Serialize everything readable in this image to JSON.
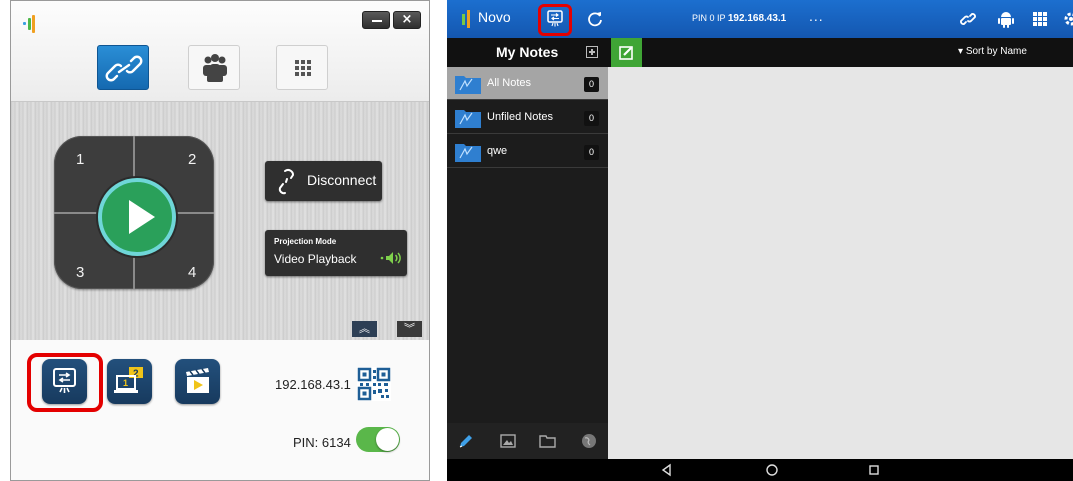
{
  "left_app": {
    "tabs": [
      {
        "name": "link",
        "active": true
      },
      {
        "name": "users",
        "active": false
      },
      {
        "name": "apps",
        "active": false
      }
    ],
    "pad_quadrants": [
      "1",
      "2",
      "3",
      "4"
    ],
    "disconnect_label": "Disconnect",
    "projection_mode": {
      "title": "Projection Mode",
      "value": "Video Playback"
    },
    "ip_address": "192.168.43.1",
    "pin_label": "PIN: 6134",
    "pin_enabled": true,
    "bottom_buttons": [
      "screen-share-icon",
      "presenter-icon",
      "video-clapper-icon"
    ],
    "highlight_color": "#e40000",
    "accent_color": "#1e7ac6"
  },
  "right_app": {
    "app_name": "Novo",
    "pin_ip_prefix": "PIN 0 IP ",
    "pin_ip_address": "192.168.43.1",
    "more": "...",
    "notes_title": "My Notes",
    "sort_label": "Sort by Name",
    "notebooks": [
      {
        "name": "All Notes",
        "count": "0",
        "selected": true
      },
      {
        "name": "Unfiled Notes",
        "count": "0",
        "selected": false
      },
      {
        "name": "qwe",
        "count": "0",
        "selected": false
      }
    ],
    "top_icons": [
      "link-icon",
      "android-icon",
      "grid-icon",
      "settings-icon"
    ],
    "bottom_tools": [
      "pen-icon",
      "image-icon",
      "folder-icon",
      "globe-icon"
    ],
    "nav": [
      "back-icon",
      "home-icon",
      "recents-icon"
    ],
    "header_color": "#1a67c4",
    "edit_color": "#3fa535"
  }
}
